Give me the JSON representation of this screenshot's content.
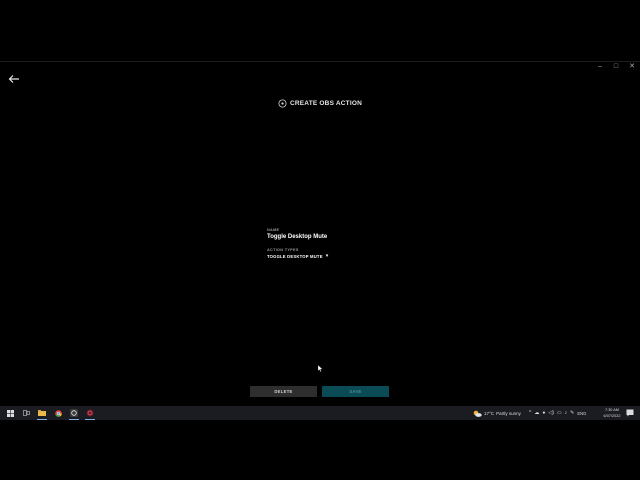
{
  "window": {
    "controls": [
      {
        "name": "minimize-button",
        "glyph": "–"
      },
      {
        "name": "maximize-button",
        "glyph": "□"
      },
      {
        "name": "close-button",
        "glyph": "✕"
      }
    ]
  },
  "header": {
    "icon": "obs-icon",
    "title": "CREATE OBS ACTION"
  },
  "form": {
    "name_label": "NAME",
    "name_value": "Toggle Desktop Mute",
    "action_label": "ACTION TYPES",
    "action_value": "TOGGLE DESKTOP MUTE",
    "action_caret": "▾"
  },
  "buttons": {
    "delete": "DELETE",
    "save": "SAVE"
  },
  "colors": {
    "save_bg": "#0a4b55",
    "delete_bg": "#2e2e2e",
    "taskbar_bg": "#1b1b22"
  },
  "taskbar": {
    "weather_temp": "17°C",
    "weather_desc": "Partly sunny",
    "tray_glyphs": [
      {
        "name": "chevron-up-icon",
        "glyph": "^"
      },
      {
        "name": "cloud-icon",
        "glyph": "☁"
      },
      {
        "name": "microphone-icon",
        "glyph": "●"
      },
      {
        "name": "volume-icon",
        "glyph": "◁)"
      },
      {
        "name": "network-icon",
        "glyph": "▭"
      },
      {
        "name": "speaker-icon",
        "glyph": "♪"
      },
      {
        "name": "pen-icon",
        "glyph": "✎"
      }
    ],
    "language": "ENG",
    "time": "7:30 AM",
    "date": "6/07/2022"
  }
}
